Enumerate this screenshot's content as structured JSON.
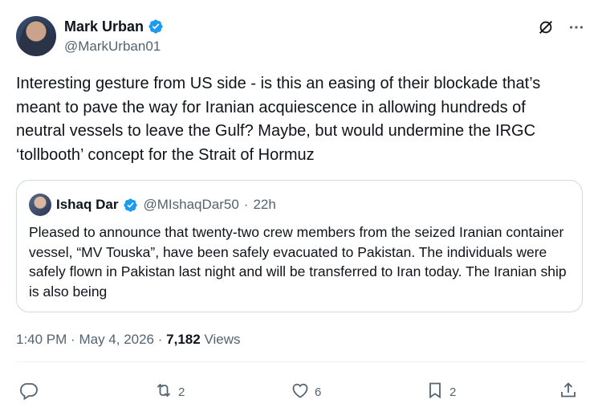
{
  "author": {
    "name": "Mark Urban",
    "handle": "@MarkUrban01"
  },
  "icons": {
    "verified": "verified-badge-icon",
    "grok": "grok-icon",
    "more": "more-icon",
    "reply": "reply-icon",
    "repost": "repost-icon",
    "like": "like-icon",
    "bookmark": "bookmark-icon",
    "share": "share-icon"
  },
  "colors": {
    "verified": "#1d9bf0",
    "muted": "#536471",
    "text": "#0f1419"
  },
  "tweet": {
    "text": "Interesting gesture from US side - is this an easing of their blockade that’s meant to pave the way for Iranian acquiescence in allowing hundreds of neutral vessels to leave the Gulf? Maybe, but would undermine the IRGC ‘tollbooth’ concept for the Strait of Hormuz"
  },
  "quote": {
    "name": "Ishaq Dar",
    "handle": "@MIshaqDar50",
    "separator": "·",
    "time": "22h",
    "text": "Pleased to announce that twenty-two crew members from the seized Iranian container vessel, “MV Touska”, have been safely evacuated to Pakistan. The individuals were safely flown in Pakistan last night and will be transferred to Iran today. The Iranian ship is also being"
  },
  "meta": {
    "time": "1:40 PM",
    "sep1": "·",
    "date": "May 4, 2026",
    "sep2": "·",
    "views_count": "7,182",
    "views_label": "Views"
  },
  "actions": {
    "reply_count": "",
    "repost_count": "2",
    "like_count": "6",
    "bookmark_count": "2"
  }
}
